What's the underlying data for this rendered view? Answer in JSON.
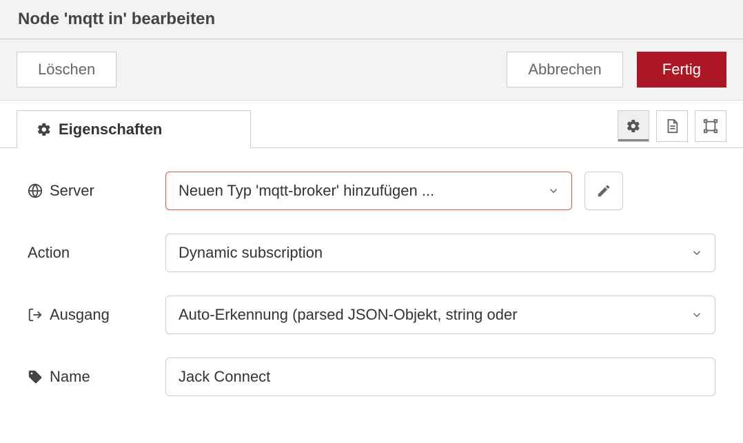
{
  "header": {
    "title": "Node 'mqtt in' bearbeiten"
  },
  "buttons": {
    "delete": "Löschen",
    "cancel": "Abbrechen",
    "done": "Fertig"
  },
  "tabs": {
    "properties": "Eigenschaften"
  },
  "form": {
    "server": {
      "label": "Server",
      "value": "Neuen Typ 'mqtt-broker' hinzufügen ..."
    },
    "action": {
      "label": "Action",
      "value": "Dynamic subscription"
    },
    "output": {
      "label": "Ausgang",
      "value": "Auto-Erkennung (parsed JSON-Objekt, string oder"
    },
    "name": {
      "label": "Name",
      "value": "Jack Connect"
    }
  }
}
